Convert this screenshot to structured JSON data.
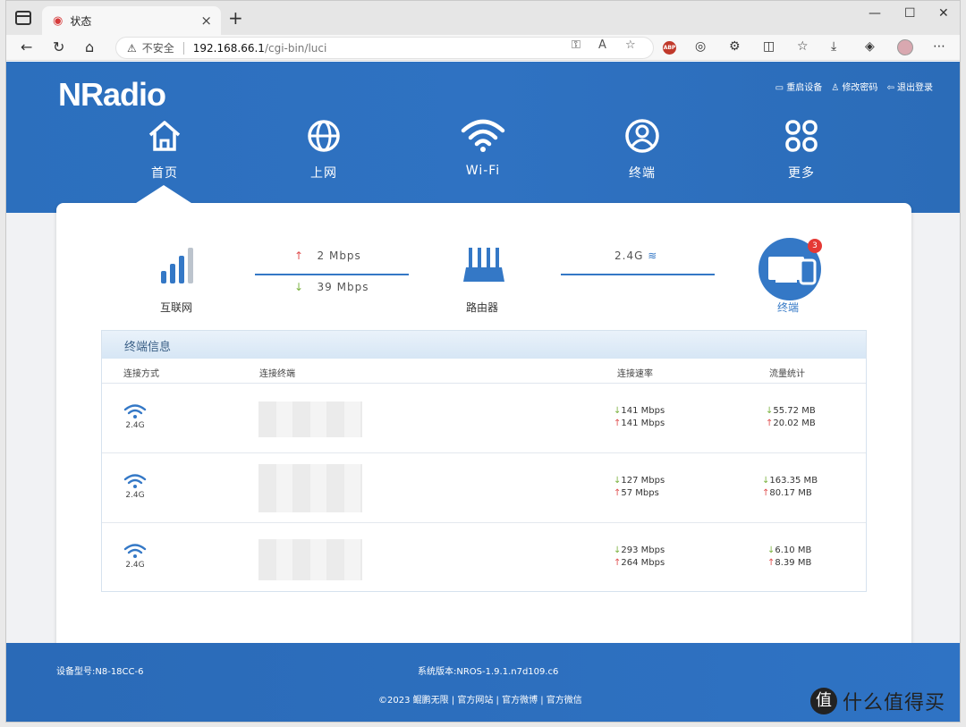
{
  "browser": {
    "tab_title": "状态",
    "address_insecure": "不安全",
    "address_host": "192.168.66.1",
    "address_path": "/cgi-bin/luci"
  },
  "header": {
    "logo": "NRadio",
    "links": [
      "重启设备",
      "修改密码",
      "退出登录"
    ]
  },
  "nav": {
    "items": [
      {
        "label": "首页",
        "icon": "home-icon"
      },
      {
        "label": "上网",
        "icon": "globe-icon"
      },
      {
        "label": "Wi-Fi",
        "icon": "wifi-icon"
      },
      {
        "label": "终端",
        "icon": "user-icon"
      },
      {
        "label": "更多",
        "icon": "more-icon"
      }
    ]
  },
  "topology": {
    "internet_label": "互联网",
    "up_speed": "2 Mbps",
    "down_speed": "39 Mbps",
    "router_label": "路由器",
    "band": "2.4G",
    "terminal_label": "终端",
    "terminal_count": "3"
  },
  "terminal_info": {
    "title": "终端信息",
    "columns": [
      "连接方式",
      "连接终端",
      "连接速率",
      "流量统计"
    ],
    "rows": [
      {
        "band": "2.4G",
        "rate_down": "141 Mbps",
        "rate_up": "141 Mbps",
        "traffic_down": "55.72 MB",
        "traffic_up": "20.02 MB"
      },
      {
        "band": "2.4G",
        "rate_down": "127 Mbps",
        "rate_up": "57 Mbps",
        "traffic_down": "163.35 MB",
        "traffic_up": "80.17 MB"
      },
      {
        "band": "2.4G",
        "rate_down": "293 Mbps",
        "rate_up": "264 Mbps",
        "traffic_down": "6.10 MB",
        "traffic_up": "8.39 MB"
      }
    ]
  },
  "footer": {
    "model": "设备型号:N8-18CC-6",
    "version": "系统版本:NROS-1.9.1.n7d109.c6",
    "copyright": "©2023 鲲鹏无限 | 官方网站 | 官方微博 | 官方微信"
  },
  "watermark": {
    "text": "什么值得买",
    "glyph": "值"
  },
  "colors": {
    "primary": "#2f72c2",
    "down_arrow": "#7cb342",
    "up_arrow": "#e05050"
  }
}
